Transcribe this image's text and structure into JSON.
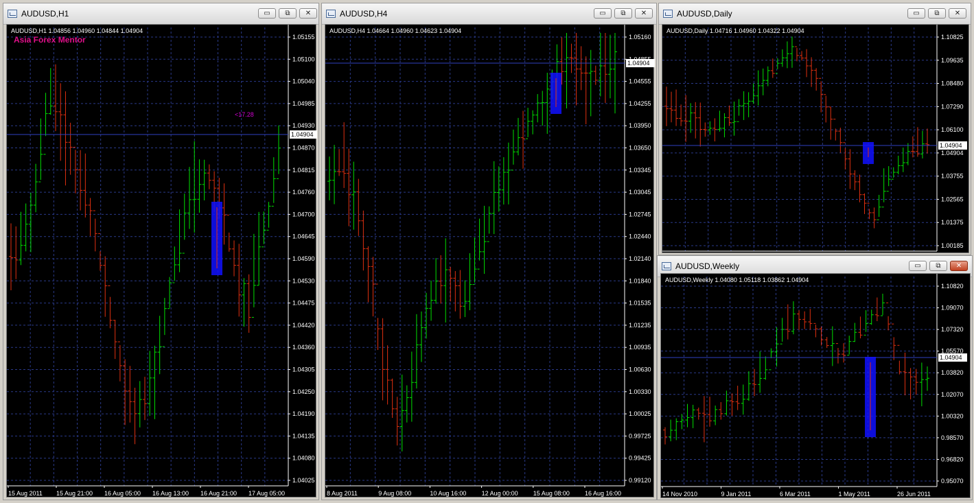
{
  "windows": [
    {
      "key": "h1",
      "title": "AUDUSD,H1",
      "ohlc_text": "AUDUSD,H1  1.04856 1.04960 1.04844 1.04904",
      "watermark": "Asia Forex Mentor",
      "annotation": "<17.28",
      "price_label": "1.04904",
      "y_ticks": [
        "1.05155",
        "1.05100",
        "1.05040",
        "1.04985",
        "1.04930",
        "1.04870",
        "1.04815",
        "1.04760",
        "1.04700",
        "1.04645",
        "1.04590",
        "1.04530",
        "1.04475",
        "1.04420",
        "1.04360",
        "1.04305",
        "1.04250",
        "1.04190",
        "1.04135",
        "1.04080",
        "1.04025"
      ],
      "x_ticks": [
        "15 Aug 2011",
        "15 Aug 21:00",
        "16 Aug 05:00",
        "16 Aug 13:00",
        "16 Aug 21:00",
        "17 Aug 05:00"
      ]
    },
    {
      "key": "h4",
      "title": "AUDUSD,H4",
      "ohlc_text": "AUDUSD,H4  1.04664 1.04960 1.04623 1.04904",
      "price_label": "1.04904",
      "y_ticks": [
        "1.05160",
        "1.04855",
        "1.04555",
        "1.04255",
        "1.03950",
        "1.03650",
        "1.03345",
        "1.03045",
        "1.02745",
        "1.02440",
        "1.02140",
        "1.01840",
        "1.01535",
        "1.01235",
        "1.00935",
        "1.00630",
        "1.00330",
        "1.00025",
        "0.99725",
        "0.99425",
        "0.99120"
      ],
      "x_ticks": [
        "8 Aug 2011",
        "9 Aug 08:00",
        "10 Aug 16:00",
        "12 Aug 00:00",
        "15 Aug 08:00",
        "16 Aug 16:00"
      ]
    },
    {
      "key": "daily",
      "title": "AUDUSD,Daily",
      "ohlc_text": "AUDUSD,Daily  1.04716 1.04960 1.04322 1.04904",
      "price_label": "1.04904",
      "y_ticks": [
        "1.10825",
        "1.09635",
        "1.08480",
        "1.07290",
        "1.06100",
        "1.04904",
        "1.03755",
        "1.02565",
        "1.01375",
        "1.00185"
      ],
      "x_ticks": []
    },
    {
      "key": "weekly",
      "title": "AUDUSD,Weekly",
      "ohlc_text": "AUDUSD,Weekly  1.04080 1.05118 1.03862 1.04904",
      "price_label": "1.04904",
      "y_ticks": [
        "1.10820",
        "1.09070",
        "1.07320",
        "1.05570",
        "1.03820",
        "1.02070",
        "1.00320",
        "0.98570",
        "0.96820",
        "0.95070"
      ],
      "x_ticks": [
        "14 Nov 2010",
        "9 Jan 2011",
        "6 Mar 2011",
        "1 May 2011",
        "26 Jun 2011"
      ]
    }
  ],
  "controls": {
    "minimize": "▭",
    "restore": "⧉",
    "close": "✕"
  },
  "colors": {
    "bull": "#00e000",
    "bear": "#e03010",
    "grid": "#2a3a8a",
    "axis_text": "#ffffff",
    "highlight": "#1010ff",
    "annotation": "#d000d0",
    "watermark": "#e0108a"
  }
}
